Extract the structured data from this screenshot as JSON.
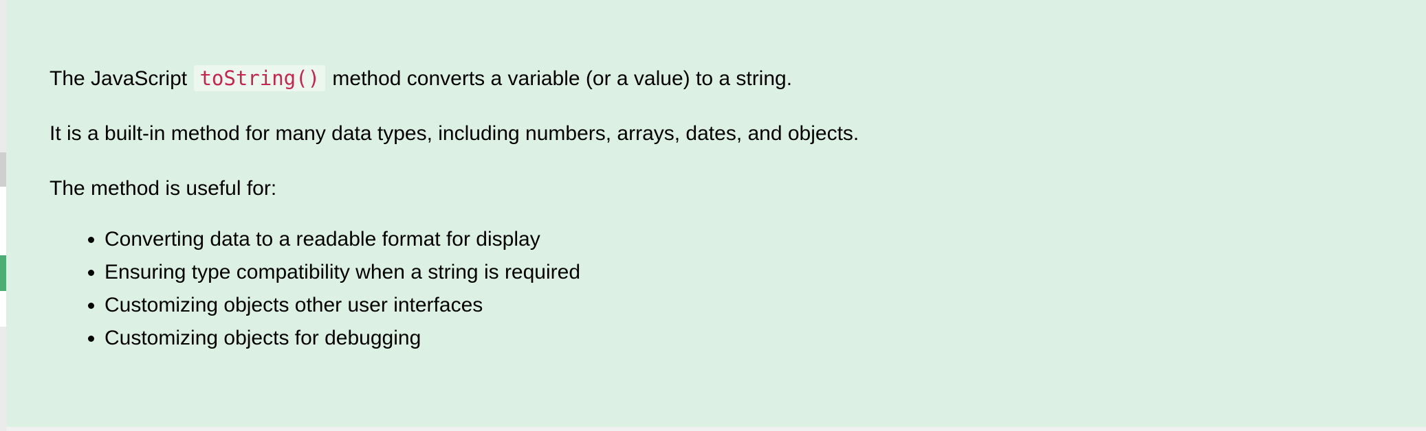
{
  "note": {
    "intro_before": "The JavaScript",
    "intro_code": "toString()",
    "intro_after": "method converts a variable (or a value) to a string.",
    "builtin": "It is a built-in method for many data types, including numbers, arrays, dates, and objects.",
    "useful_for": "The method is useful for:",
    "uses": [
      "Converting data to a readable format for display",
      "Ensuring type compatibility when a string is required",
      "Customizing objects other user interfaces",
      "Customizing objects for debugging"
    ]
  },
  "colors": {
    "panel_background": "#ddf0e4",
    "code_text": "#c7254e",
    "side_accent": "#4cae75"
  }
}
